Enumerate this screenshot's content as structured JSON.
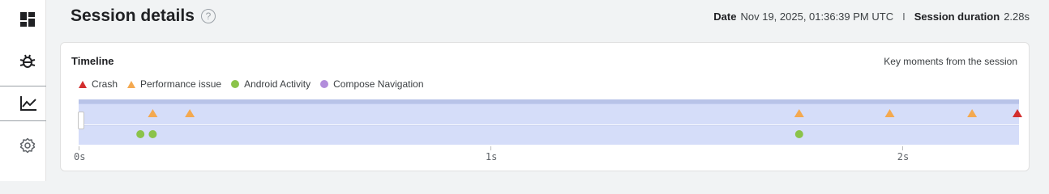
{
  "rail": {
    "items": [
      {
        "icon": "dashboard-icon"
      },
      {
        "icon": "bug-icon"
      },
      {
        "icon": "timeline-chart-icon",
        "active": true
      },
      {
        "icon": "settings-icon"
      }
    ]
  },
  "header": {
    "title": "Session details",
    "help": "?",
    "date_label": "Date",
    "date_value": "Nov 19, 2025, 01:36:39 PM UTC",
    "separator": "I",
    "duration_label": "Session duration",
    "duration_value": "2.28s"
  },
  "card": {
    "title": "Timeline",
    "subtitle": "Key moments from the session",
    "legend": [
      {
        "label": "Crash",
        "shape": "triangle",
        "color": "#d32f2f"
      },
      {
        "label": "Performance issue",
        "shape": "triangle",
        "color": "#f4a950"
      },
      {
        "label": "Android Activity",
        "shape": "circle",
        "color": "#8bc34a"
      },
      {
        "label": "Compose Navigation",
        "shape": "circle",
        "color": "#b28ddb"
      }
    ]
  },
  "chart_data": {
    "type": "scatter",
    "xlim": [
      0,
      2.28
    ],
    "xunit": "s",
    "tick_labels": [
      {
        "label": "0s",
        "x": 0
      },
      {
        "label": "1s",
        "x": 1
      },
      {
        "label": "2s",
        "x": 2
      }
    ],
    "series": [
      {
        "name": "Crash",
        "lane": 1,
        "shape": "triangle",
        "color": "#d32f2f",
        "x": [
          2.28
        ]
      },
      {
        "name": "Performance issue",
        "lane": 1,
        "shape": "triangle",
        "color": "#f4a950",
        "x": [
          0.18,
          0.27,
          1.75,
          1.97,
          2.17
        ]
      },
      {
        "name": "Android Activity",
        "lane": 2,
        "shape": "circle",
        "color": "#8bc34a",
        "x": [
          0.15,
          0.18,
          1.75
        ]
      }
    ]
  }
}
